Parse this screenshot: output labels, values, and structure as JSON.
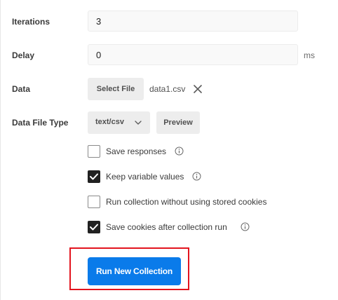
{
  "form": {
    "iterations": {
      "label": "Iterations",
      "value": "3"
    },
    "delay": {
      "label": "Delay",
      "value": "0",
      "unit": "ms"
    },
    "data": {
      "label": "Data",
      "select_file_label": "Select File",
      "file_name": "data1.csv"
    },
    "data_file_type": {
      "label": "Data File Type",
      "selected": "text/csv",
      "preview_label": "Preview"
    }
  },
  "options": [
    {
      "label": "Save responses",
      "checked": false,
      "info_icon": true
    },
    {
      "label": "Keep variable values",
      "checked": true,
      "info_icon": true
    },
    {
      "label": "Run collection without using stored cookies",
      "checked": false,
      "info_icon": false
    },
    {
      "label": "Save cookies after collection run",
      "checked": true,
      "info_icon": true
    }
  ],
  "run_button": {
    "label": "Run New Collection"
  },
  "colors": {
    "accent": "#0a7bea",
    "highlight": "#e3141e",
    "checkbox_checked": "#212121"
  },
  "icons": [
    "close-icon",
    "chevron-down-icon",
    "info-icon",
    "check-icon"
  ]
}
